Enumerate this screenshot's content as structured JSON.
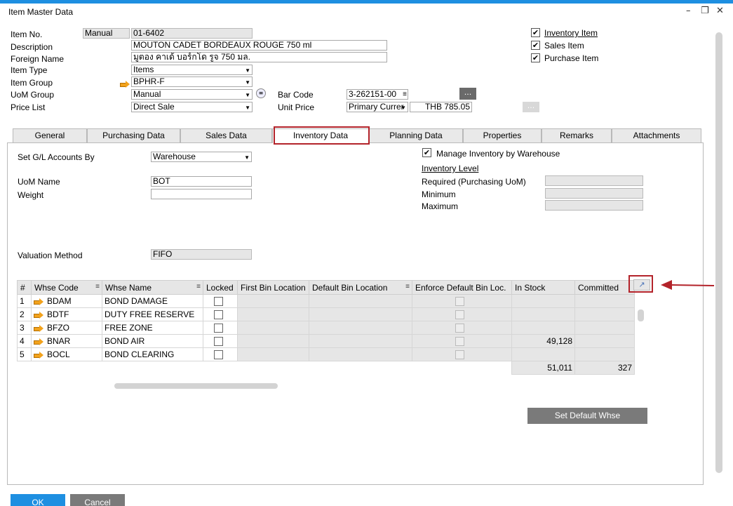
{
  "window": {
    "title": "Item Master Data"
  },
  "header": {
    "item_no_label": "Item No.",
    "item_no_series": "Manual",
    "item_no_value": "01-6402",
    "description_label": "Description",
    "description_value": "MOUTON CADET BORDEAUX ROUGE 750 ml",
    "foreign_name_label": "Foreign Name",
    "foreign_name_value": "มูตอง คาเด้ บอร์กโด รูจ 750 มล.",
    "item_type_label": "Item Type",
    "item_type_value": "Items",
    "item_group_label": "Item Group",
    "item_group_value": "BPHR-F",
    "uom_group_label": "UoM Group",
    "uom_group_value": "Manual",
    "price_list_label": "Price List",
    "price_list_value": "Direct Sale",
    "bar_code_label": "Bar Code",
    "bar_code_value": "3-262151-00",
    "unit_price_label": "Unit Price",
    "unit_price_currency": "Primary Currer",
    "unit_price_value": "THB 785.05",
    "ellipsis": "...",
    "inventory_item_label": "Inventory Item",
    "sales_item_label": "Sales Item",
    "purchase_item_label": "Purchase Item"
  },
  "tabs": [
    {
      "label": "General"
    },
    {
      "label": "Purchasing Data"
    },
    {
      "label": "Sales Data"
    },
    {
      "label": "Inventory Data"
    },
    {
      "label": "Planning Data"
    },
    {
      "label": "Properties"
    },
    {
      "label": "Remarks"
    },
    {
      "label": "Attachments"
    }
  ],
  "inventory": {
    "set_gl_label": "Set G/L Accounts By",
    "set_gl_value": "Warehouse",
    "uom_name_label": "UoM Name",
    "uom_name_value": "BOT",
    "weight_label": "Weight",
    "weight_value": "",
    "valuation_label": "Valuation Method",
    "valuation_value": "FIFO",
    "manage_by_whse_label": "Manage Inventory by Warehouse",
    "inventory_level_label": "Inventory Level",
    "required_label": "Required (Purchasing UoM)",
    "minimum_label": "Minimum",
    "maximum_label": "Maximum"
  },
  "grid": {
    "columns": [
      "#",
      "Whse Code",
      "Whse Name",
      "Locked",
      "First Bin Location",
      "Default Bin Location",
      "Enforce Default Bin Loc.",
      "In Stock",
      "Committed"
    ],
    "rows": [
      {
        "num": "1",
        "code": "BDAM",
        "name": "BOND DAMAGE",
        "in_stock": "",
        "committed": ""
      },
      {
        "num": "2",
        "code": "BDTF",
        "name": "DUTY FREE RESERVE",
        "in_stock": "",
        "committed": ""
      },
      {
        "num": "3",
        "code": "BFZO",
        "name": "FREE ZONE",
        "in_stock": "",
        "committed": ""
      },
      {
        "num": "4",
        "code": "BNAR",
        "name": "BOND AIR",
        "in_stock": "49,128",
        "committed": ""
      },
      {
        "num": "5",
        "code": "BOCL",
        "name": "BOND CLEARING",
        "in_stock": "",
        "committed": ""
      }
    ],
    "total_in_stock": "51,011",
    "total_committed": "327"
  },
  "buttons": {
    "set_default_whse": "Set Default Whse",
    "ok": "OK",
    "cancel": "Cancel"
  },
  "colors": {
    "accent": "#1e8fe1",
    "highlight": "#b3232a",
    "button": "#7a7a7a"
  }
}
